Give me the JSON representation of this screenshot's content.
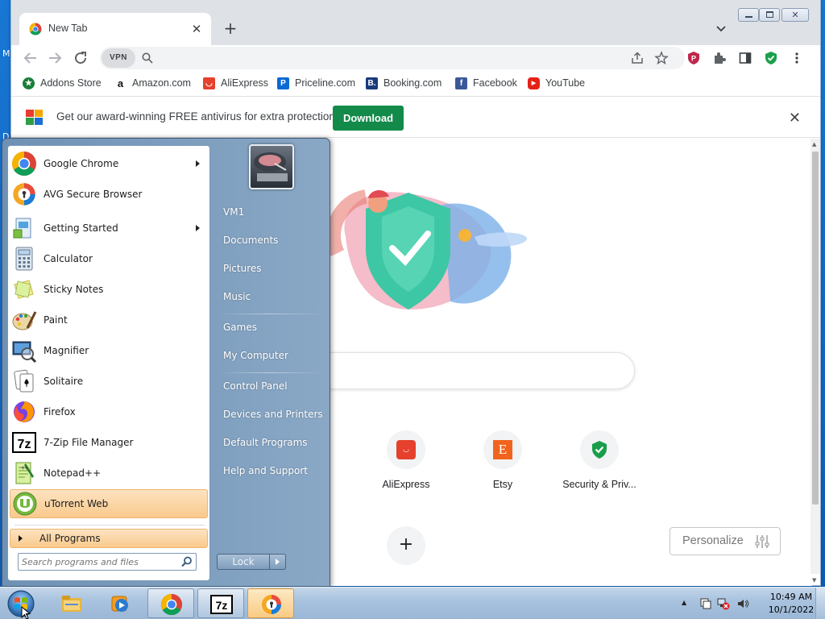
{
  "desktop": {
    "stray_letters": [
      "M",
      "D"
    ]
  },
  "browser": {
    "tab": {
      "title": "New Tab"
    },
    "toolbar": {
      "vpn_label": "VPN",
      "address_value": "",
      "address_placeholder": ""
    },
    "bookmarks": [
      {
        "label": "Addons Store",
        "icon": "addons-icon",
        "color": "#1a7f37"
      },
      {
        "label": "Amazon.com",
        "icon": "amazon-icon",
        "color": "#ffffff"
      },
      {
        "label": "AliExpress",
        "icon": "aliexpress-icon",
        "color": "#e5412d"
      },
      {
        "label": "Priceline.com",
        "icon": "priceline-icon",
        "color": "#0a6ad4"
      },
      {
        "label": "Booking.com",
        "icon": "booking-icon",
        "color": "#1a3a7a"
      },
      {
        "label": "Facebook",
        "icon": "facebook-icon",
        "color": "#3b5998"
      },
      {
        "label": "YouTube",
        "icon": "youtube-icon",
        "color": "#e62117"
      }
    ],
    "infobar": {
      "message": "Get our award-winning FREE antivirus for extra protection",
      "button": "Download",
      "button_color": "#138a4a"
    },
    "newtab": {
      "shortcuts": [
        {
          "label": "AliExpress",
          "icon": "aliexpress-icon"
        },
        {
          "label": "Etsy",
          "icon": "etsy-icon"
        },
        {
          "label": "Security & Priv...",
          "icon": "security-shield-icon"
        }
      ],
      "personalize": "Personalize"
    }
  },
  "startmenu": {
    "programs": [
      {
        "label": "Google Chrome",
        "icon": "chrome-icon",
        "submenu": true
      },
      {
        "label": "AVG Secure Browser",
        "icon": "avg-browser-icon",
        "submenu": false
      },
      {
        "label": "Getting Started",
        "icon": "getting-started-icon",
        "submenu": true
      },
      {
        "label": "Calculator",
        "icon": "calculator-icon",
        "submenu": false
      },
      {
        "label": "Sticky Notes",
        "icon": "sticky-notes-icon",
        "submenu": false
      },
      {
        "label": "Paint",
        "icon": "paint-icon",
        "submenu": false
      },
      {
        "label": "Magnifier",
        "icon": "magnifier-icon",
        "submenu": false
      },
      {
        "label": "Solitaire",
        "icon": "solitaire-icon",
        "submenu": false
      },
      {
        "label": "Firefox",
        "icon": "firefox-icon",
        "submenu": false
      },
      {
        "label": "7-Zip File Manager",
        "icon": "7zip-icon",
        "submenu": false
      },
      {
        "label": "Notepad++",
        "icon": "notepadpp-icon",
        "submenu": false
      },
      {
        "label": "uTorrent Web",
        "icon": "utorrent-icon",
        "submenu": false,
        "highlighted": true
      }
    ],
    "all_programs": "All Programs",
    "search_placeholder": "Search programs and files",
    "right_items": [
      "VM1",
      "Documents",
      "Pictures",
      "Music",
      "Games",
      "My Computer",
      "Control Panel",
      "Devices and Printers",
      "Default Programs",
      "Help and Support"
    ],
    "lock_label": "Lock"
  },
  "taskbar": {
    "items": [
      {
        "icon": "explorer-icon",
        "state": "pinned"
      },
      {
        "icon": "media-player-icon",
        "state": "pinned"
      },
      {
        "icon": "chrome-icon",
        "state": "running"
      },
      {
        "icon": "7zip-icon",
        "state": "running"
      },
      {
        "icon": "avg-browser-icon",
        "state": "active"
      }
    ],
    "clock_time": "10:49 AM",
    "clock_date": "10/1/2022"
  }
}
